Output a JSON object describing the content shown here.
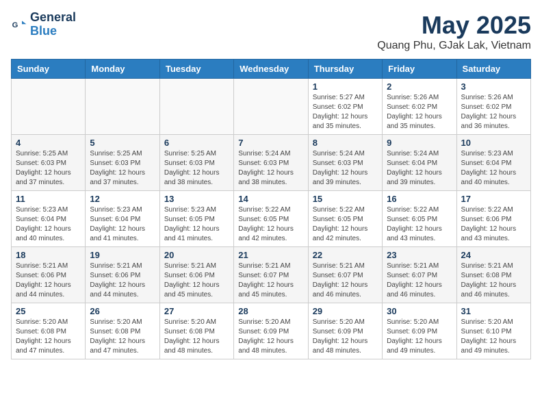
{
  "logo": {
    "line1": "General",
    "line2": "Blue"
  },
  "title": "May 2025",
  "subtitle": "Quang Phu, GJak Lak, Vietnam",
  "weekdays": [
    "Sunday",
    "Monday",
    "Tuesday",
    "Wednesday",
    "Thursday",
    "Friday",
    "Saturday"
  ],
  "weeks": [
    [
      {
        "day": "",
        "info": ""
      },
      {
        "day": "",
        "info": ""
      },
      {
        "day": "",
        "info": ""
      },
      {
        "day": "",
        "info": ""
      },
      {
        "day": "1",
        "info": "Sunrise: 5:27 AM\nSunset: 6:02 PM\nDaylight: 12 hours\nand 35 minutes."
      },
      {
        "day": "2",
        "info": "Sunrise: 5:26 AM\nSunset: 6:02 PM\nDaylight: 12 hours\nand 35 minutes."
      },
      {
        "day": "3",
        "info": "Sunrise: 5:26 AM\nSunset: 6:02 PM\nDaylight: 12 hours\nand 36 minutes."
      }
    ],
    [
      {
        "day": "4",
        "info": "Sunrise: 5:25 AM\nSunset: 6:03 PM\nDaylight: 12 hours\nand 37 minutes."
      },
      {
        "day": "5",
        "info": "Sunrise: 5:25 AM\nSunset: 6:03 PM\nDaylight: 12 hours\nand 37 minutes."
      },
      {
        "day": "6",
        "info": "Sunrise: 5:25 AM\nSunset: 6:03 PM\nDaylight: 12 hours\nand 38 minutes."
      },
      {
        "day": "7",
        "info": "Sunrise: 5:24 AM\nSunset: 6:03 PM\nDaylight: 12 hours\nand 38 minutes."
      },
      {
        "day": "8",
        "info": "Sunrise: 5:24 AM\nSunset: 6:03 PM\nDaylight: 12 hours\nand 39 minutes."
      },
      {
        "day": "9",
        "info": "Sunrise: 5:24 AM\nSunset: 6:04 PM\nDaylight: 12 hours\nand 39 minutes."
      },
      {
        "day": "10",
        "info": "Sunrise: 5:23 AM\nSunset: 6:04 PM\nDaylight: 12 hours\nand 40 minutes."
      }
    ],
    [
      {
        "day": "11",
        "info": "Sunrise: 5:23 AM\nSunset: 6:04 PM\nDaylight: 12 hours\nand 40 minutes."
      },
      {
        "day": "12",
        "info": "Sunrise: 5:23 AM\nSunset: 6:04 PM\nDaylight: 12 hours\nand 41 minutes."
      },
      {
        "day": "13",
        "info": "Sunrise: 5:23 AM\nSunset: 6:05 PM\nDaylight: 12 hours\nand 41 minutes."
      },
      {
        "day": "14",
        "info": "Sunrise: 5:22 AM\nSunset: 6:05 PM\nDaylight: 12 hours\nand 42 minutes."
      },
      {
        "day": "15",
        "info": "Sunrise: 5:22 AM\nSunset: 6:05 PM\nDaylight: 12 hours\nand 42 minutes."
      },
      {
        "day": "16",
        "info": "Sunrise: 5:22 AM\nSunset: 6:05 PM\nDaylight: 12 hours\nand 43 minutes."
      },
      {
        "day": "17",
        "info": "Sunrise: 5:22 AM\nSunset: 6:06 PM\nDaylight: 12 hours\nand 43 minutes."
      }
    ],
    [
      {
        "day": "18",
        "info": "Sunrise: 5:21 AM\nSunset: 6:06 PM\nDaylight: 12 hours\nand 44 minutes."
      },
      {
        "day": "19",
        "info": "Sunrise: 5:21 AM\nSunset: 6:06 PM\nDaylight: 12 hours\nand 44 minutes."
      },
      {
        "day": "20",
        "info": "Sunrise: 5:21 AM\nSunset: 6:06 PM\nDaylight: 12 hours\nand 45 minutes."
      },
      {
        "day": "21",
        "info": "Sunrise: 5:21 AM\nSunset: 6:07 PM\nDaylight: 12 hours\nand 45 minutes."
      },
      {
        "day": "22",
        "info": "Sunrise: 5:21 AM\nSunset: 6:07 PM\nDaylight: 12 hours\nand 46 minutes."
      },
      {
        "day": "23",
        "info": "Sunrise: 5:21 AM\nSunset: 6:07 PM\nDaylight: 12 hours\nand 46 minutes."
      },
      {
        "day": "24",
        "info": "Sunrise: 5:21 AM\nSunset: 6:08 PM\nDaylight: 12 hours\nand 46 minutes."
      }
    ],
    [
      {
        "day": "25",
        "info": "Sunrise: 5:20 AM\nSunset: 6:08 PM\nDaylight: 12 hours\nand 47 minutes."
      },
      {
        "day": "26",
        "info": "Sunrise: 5:20 AM\nSunset: 6:08 PM\nDaylight: 12 hours\nand 47 minutes."
      },
      {
        "day": "27",
        "info": "Sunrise: 5:20 AM\nSunset: 6:08 PM\nDaylight: 12 hours\nand 48 minutes."
      },
      {
        "day": "28",
        "info": "Sunrise: 5:20 AM\nSunset: 6:09 PM\nDaylight: 12 hours\nand 48 minutes."
      },
      {
        "day": "29",
        "info": "Sunrise: 5:20 AM\nSunset: 6:09 PM\nDaylight: 12 hours\nand 48 minutes."
      },
      {
        "day": "30",
        "info": "Sunrise: 5:20 AM\nSunset: 6:09 PM\nDaylight: 12 hours\nand 49 minutes."
      },
      {
        "day": "31",
        "info": "Sunrise: 5:20 AM\nSunset: 6:10 PM\nDaylight: 12 hours\nand 49 minutes."
      }
    ]
  ]
}
